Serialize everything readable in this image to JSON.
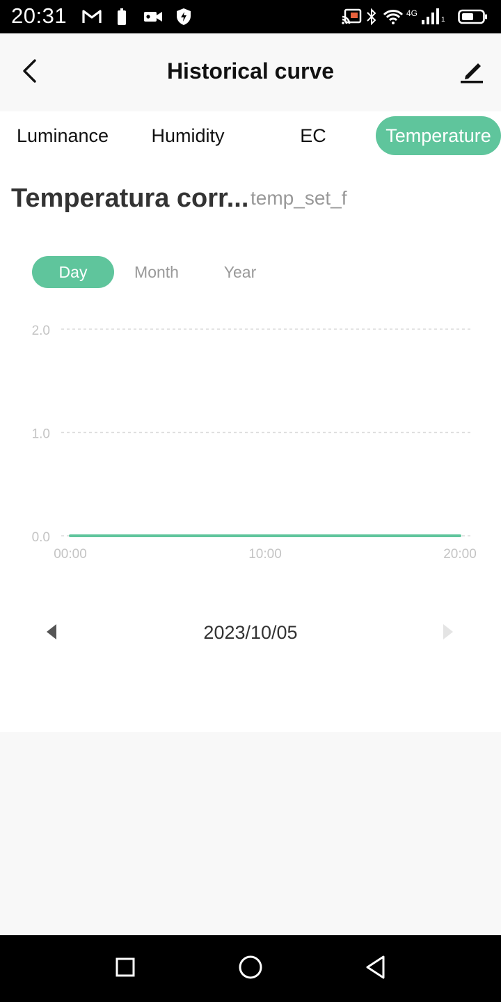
{
  "status_bar": {
    "time": "20:31",
    "network_label": "4G",
    "signal_sub": "1",
    "icons": [
      "gmail-icon",
      "battery-saver-icon",
      "video-icon",
      "shield-icon",
      "cast-icon",
      "bluetooth-icon",
      "wifi-icon",
      "signal-icon",
      "battery-icon"
    ]
  },
  "header": {
    "title": "Historical curve",
    "back_icon": "chevron-left-icon",
    "edit_icon": "pencil-icon"
  },
  "category_tabs": [
    {
      "label": "Luminance",
      "active": false
    },
    {
      "label": "Humidity",
      "active": false
    },
    {
      "label": "EC",
      "active": false
    },
    {
      "label": "Temperature",
      "active": true
    }
  ],
  "sensor": {
    "title": "Temperatura corr...",
    "code": "temp_set_f"
  },
  "period_tabs": [
    {
      "label": "Day",
      "active": true
    },
    {
      "label": "Month",
      "active": false
    },
    {
      "label": "Year",
      "active": false
    }
  ],
  "chart_data": {
    "type": "line",
    "x_ticks": [
      "00:00",
      "10:00",
      "20:00"
    ],
    "y_ticks": [
      "2.0",
      "1.0",
      "0.0"
    ],
    "ylim": [
      0,
      2
    ],
    "xlim": [
      0,
      20
    ],
    "series": [
      {
        "x": [
          0,
          20
        ],
        "values": [
          0,
          0
        ]
      }
    ],
    "grid": "horizontal-dashed",
    "line_color": "#5fc59c"
  },
  "date_nav": {
    "date": "2023/10/05",
    "prev_icon": "triangle-left-icon",
    "next_icon": "triangle-right-icon"
  },
  "nav_bar": {
    "icons": [
      "square-icon",
      "circle-icon",
      "triangle-back-icon"
    ]
  },
  "colors": {
    "accent": "#5fc59c"
  }
}
